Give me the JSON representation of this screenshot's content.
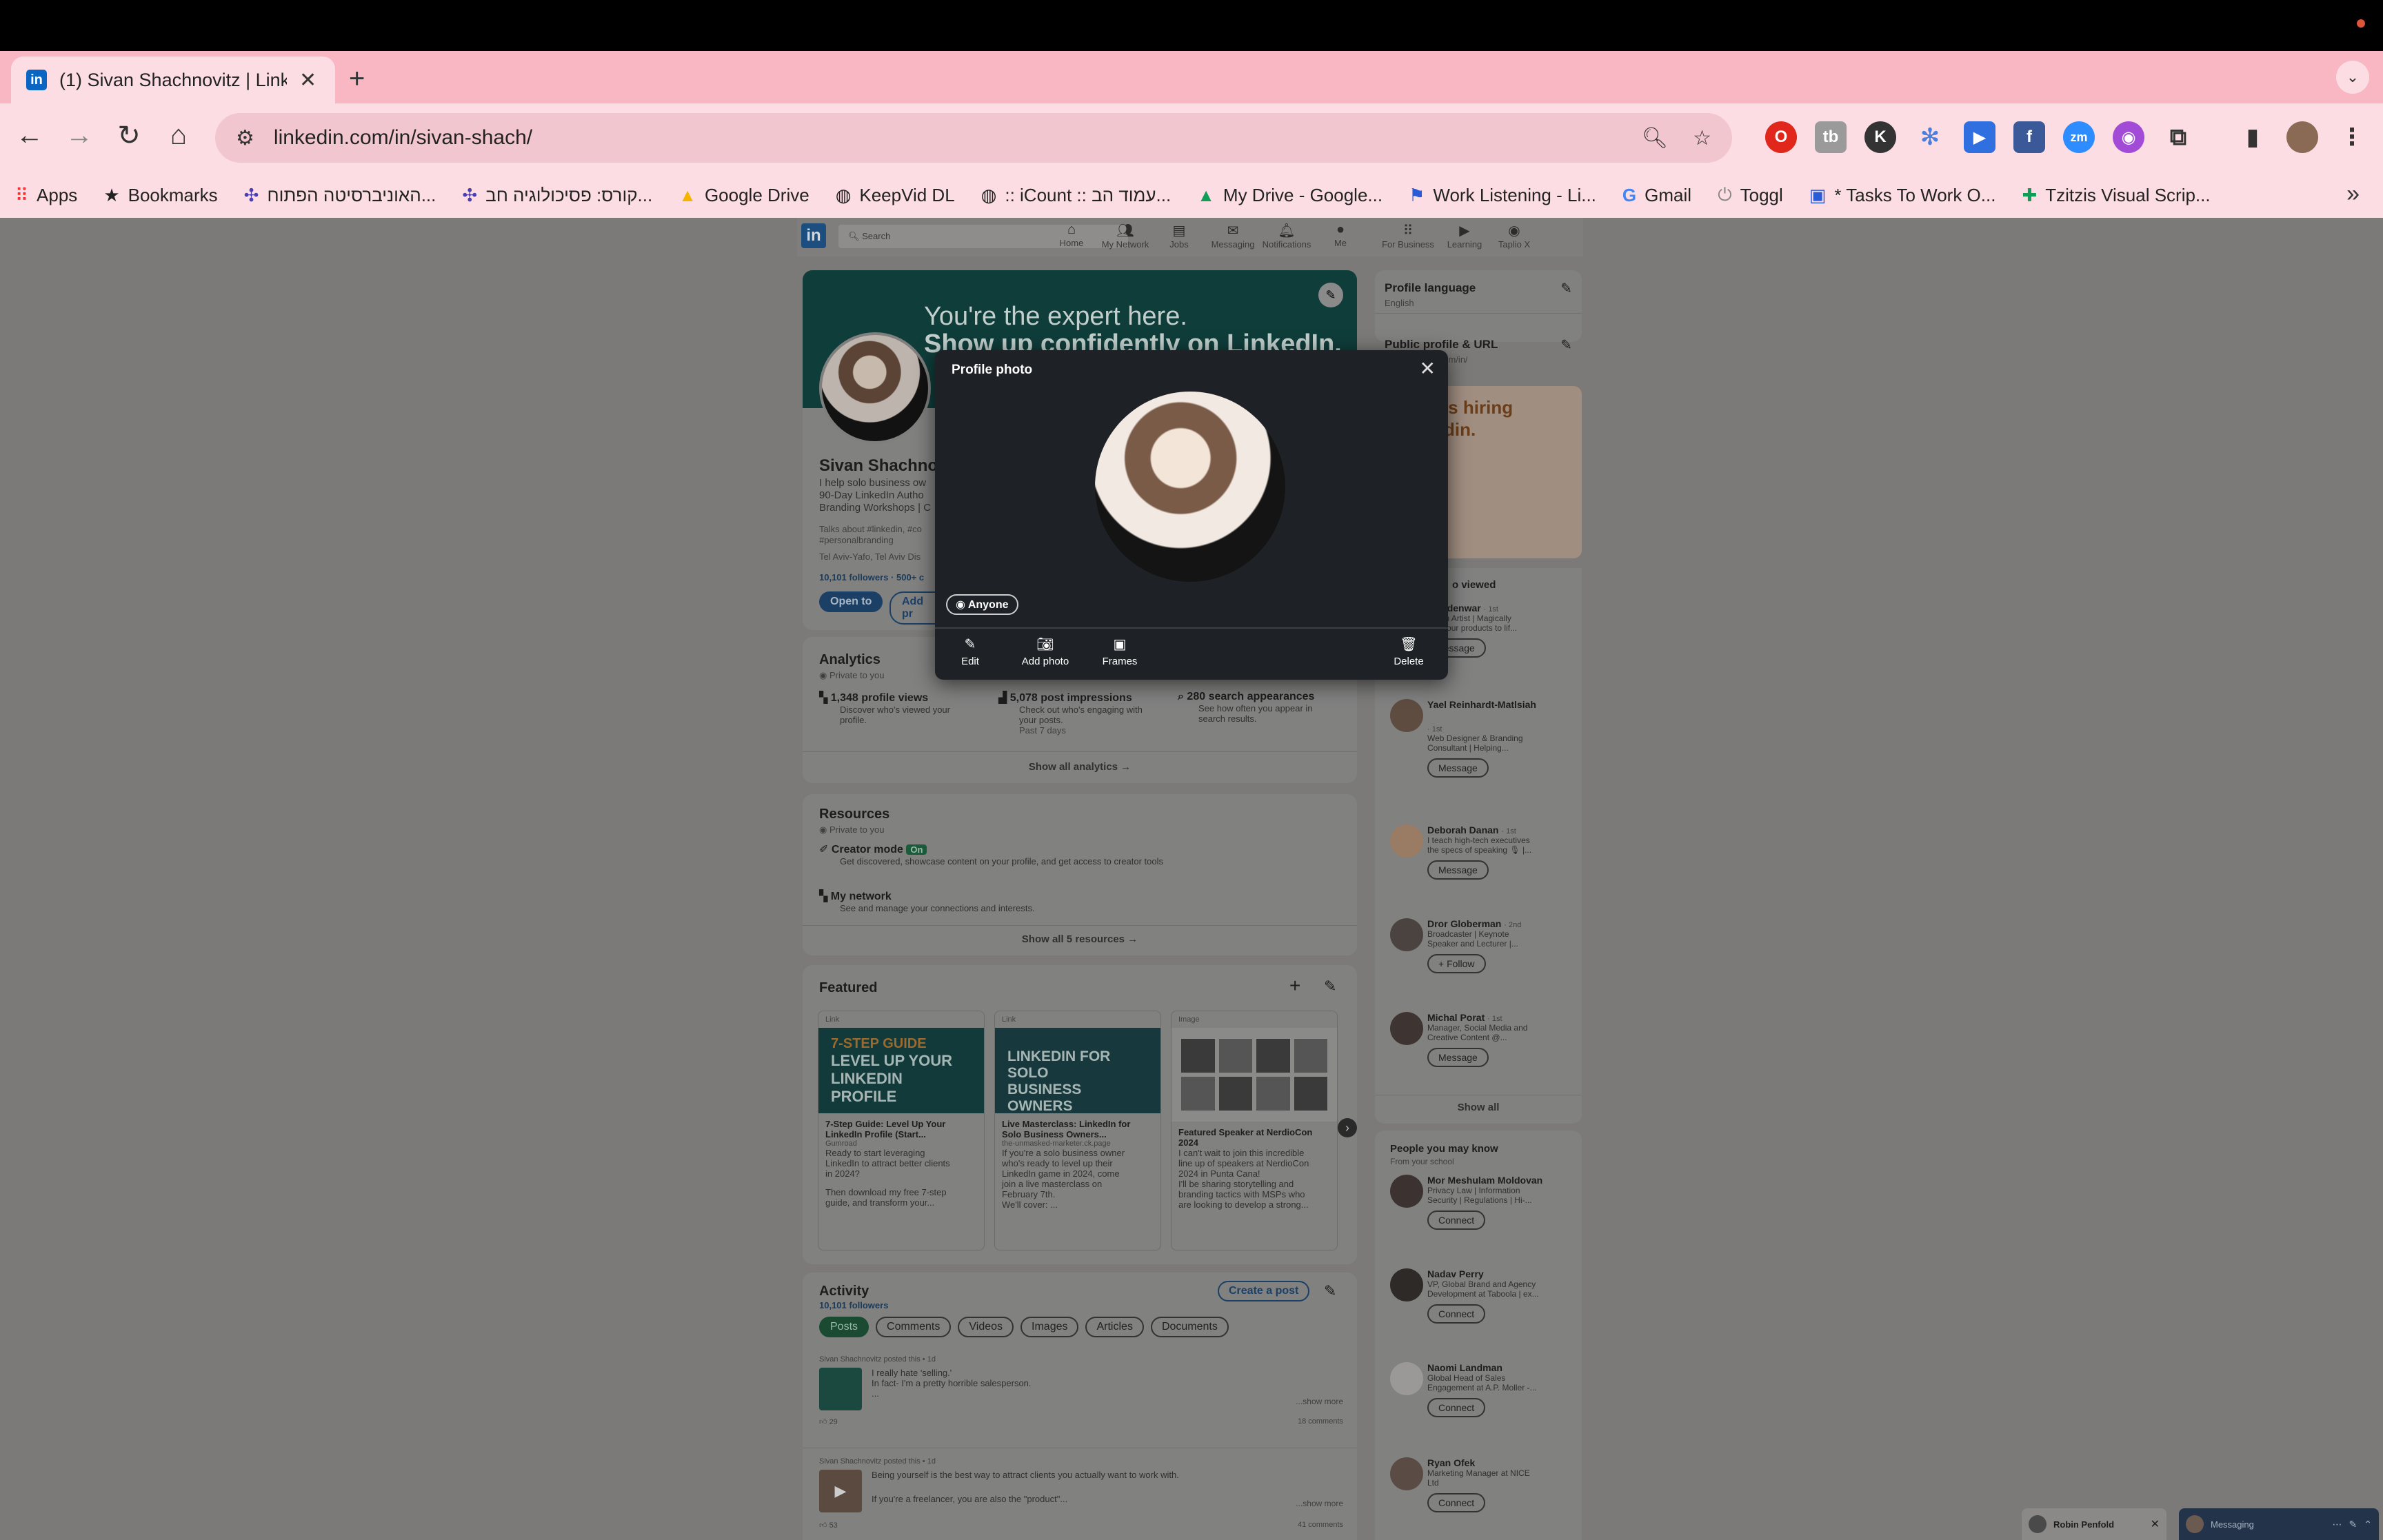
{
  "browser": {
    "tab_title": "(1) Sivan Shachnovitz | LinkedIn",
    "url": "linkedin.com/in/sivan-shach/",
    "bookmarks": [
      "Apps",
      "Bookmarks",
      "האוניברסיטה הפתוח...",
      "קורס: פסיכולוגיה חב...",
      "Google Drive",
      "KeepVid DL",
      ":: iCount :: עמוד הב...",
      "My Drive - Google...",
      "Work Listening - Li...",
      "Gmail",
      "Toggl",
      "* Tasks To Work O...",
      "Tzitzis Visual Scrip..."
    ]
  },
  "linkedin_nav": {
    "search_placeholder": "Search",
    "items": [
      "Home",
      "My Network",
      "Jobs",
      "Messaging",
      "Notifications",
      "Me",
      "For Business",
      "Learning",
      "Taplio X"
    ]
  },
  "profile": {
    "banner_line1": "You're the expert here.",
    "banner_line2": "Show up confidently on LinkedIn.",
    "name": "Sivan Shachnov",
    "headline_1": "I help solo business ow",
    "headline_2": "90-Day LinkedIn Autho",
    "headline_3": "Branding Workshops | C",
    "talks_about": "Talks about #linkedin, #co",
    "hashtag": "#personalbranding",
    "location": "Tel Aviv-Yafo, Tel Aviv Dis",
    "followers": "10,101 followers · 500+ c",
    "open_to": "Open to",
    "add_section": "Add pr"
  },
  "analytics": {
    "title": "Analytics",
    "private": "Private to you",
    "items": [
      {
        "title": "1,348 profile views",
        "desc1": "Discover who's viewed your",
        "desc2": "profile."
      },
      {
        "title": "5,078 post impressions",
        "desc1": "Check out who's engaging with",
        "desc2": "your posts.",
        "desc3": "Past 7 days"
      },
      {
        "title": "280 search appearances",
        "desc1": "See how often you appear in",
        "desc2": "search results."
      }
    ],
    "show_all": "Show all analytics →"
  },
  "resources": {
    "title": "Resources",
    "private": "Private to you",
    "creator_mode": "Creator mode",
    "creator_badge": "On",
    "creator_desc": "Get discovered, showcase content on your profile, and get access to creator tools",
    "network": "My network",
    "network_desc": "See and manage your connections and interests.",
    "show_all": "Show all 5 resources →"
  },
  "featured": {
    "title": "Featured",
    "items": [
      {
        "type": "Link",
        "img_l1": "7-STEP GUIDE",
        "img_l2": "LEVEL UP YOUR",
        "img_l3": "LINKEDIN PROFILE",
        "title1": "7-Step Guide: Level Up Your",
        "title2": "LinkedIn Profile (Start...",
        "source": "Gumroad",
        "d1": "Ready to start leveraging",
        "d2": "LinkedIn to attract better clients",
        "d3": "in 2024?",
        "d4": "Then download my free 7-step",
        "d5": "guide, and transform your..."
      },
      {
        "type": "Link",
        "img_l1": "LINKEDIN FOR SOLO",
        "img_l2": "BUSINESS OWNERS",
        "title1": "Live Masterclass: LinkedIn for",
        "title2": "Solo Business Owners...",
        "source": "the-unmasked-marketer.ck.page",
        "d1": "If you're a solo business owner",
        "d2": "who's ready to level up their",
        "d3": "LinkedIn game in 2024, come",
        "d4": "join a live masterclass on",
        "d5": "February 7th.",
        "d6": "We'll cover: ..."
      },
      {
        "type": "Image",
        "title1": "Featured Speaker at NerdioCon",
        "title2": "2024",
        "d1": "I can't wait to join this incredible",
        "d2": "line up of speakers at NerdioCon",
        "d3": "2024 in Punta Cana!",
        "d4": "I'll be sharing storytelling and",
        "d5": "branding tactics with MSPs who",
        "d6": "are looking to develop a strong..."
      }
    ]
  },
  "activity": {
    "title": "Activity",
    "followers": "10,101 followers",
    "create_post": "Create a post",
    "tabs": [
      "Posts",
      "Comments",
      "Videos",
      "Images",
      "Articles",
      "Documents"
    ],
    "posts": [
      {
        "meta": "Sivan Shachnovitz posted this • 1d",
        "line1": "I really hate 'selling.'",
        "line2": "In fact- I'm a pretty horrible salesperson.",
        "line3": "...",
        "more": "...show more",
        "reactions": "29",
        "comments": "18 comments"
      },
      {
        "meta": "Sivan Shachnovitz posted this • 1d",
        "line1": "Being yourself is the best way to attract clients you actually want to work with.",
        "line2": "If you're a freelancer, you are also the \"product\"...",
        "more": "...show more",
        "reactions": "53",
        "comments": "41 comments"
      }
    ]
  },
  "sidebar": {
    "profile_language": "Profile language",
    "language": "English",
    "public_profile": "Public profile & URL",
    "public_url": "www.linkedin.com/in/sivan-shach",
    "ad_line1": "'s hiring",
    "ad_line2": "din.",
    "viewed_title": "o viewed",
    "viewed": [
      {
        "name": "a Seidenwar",
        "deg": "· 1st",
        "d1": "Motion Artist | Magically",
        "d2": "ging your products to lif...",
        "btn": "Message"
      },
      {
        "name": "Yael Reinhardt-Matlsiah",
        "deg": "· 1st",
        "d1": "Web Designer & Branding",
        "d2": "Consultant | Helping...",
        "btn": "Message"
      },
      {
        "name": "Deborah Danan",
        "deg": "· 1st",
        "d1": "I teach high-tech executives",
        "d2": "the specs of speaking 🎙 |...",
        "btn": "Message"
      },
      {
        "name": "Dror Globerman",
        "deg": "· 2nd",
        "d1": "Broadcaster | Keynote",
        "d2": "Speaker and Lecturer |...",
        "btn": "+ Follow"
      },
      {
        "name": "Michal Porat",
        "deg": "· 1st",
        "d1": "Manager, Social Media and",
        "d2": "Creative Content @...",
        "btn": "Message"
      }
    ],
    "show_all": "Show all",
    "pymk_title": "People you may know",
    "pymk_sub": "From your school",
    "pymk": [
      {
        "name": "Mor Meshulam Moldovan",
        "d1": "Privacy Law | Information",
        "d2": "Security | Regulations | Hi-...",
        "btn": "Connect"
      },
      {
        "name": "Nadav Perry",
        "d1": "VP, Global Brand and Agency",
        "d2": "Development at Taboola | ex...",
        "btn": "Connect"
      },
      {
        "name": "Naomi Landman",
        "d1": "Global Head of Sales",
        "d2": "Engagement at A.P. Moller -...",
        "btn": "Connect"
      },
      {
        "name": "Ryan Ofek",
        "d1": "Marketing Manager at NICE",
        "d2": "Ltd",
        "btn": "Connect"
      }
    ]
  },
  "messaging": {
    "chat_name": "Robin Penfold",
    "label": "Messaging"
  },
  "modal": {
    "title": "Profile photo",
    "visibility": "Anyone",
    "edit": "Edit",
    "add_photo": "Add photo",
    "frames": "Frames",
    "delete": "Delete"
  },
  "colors": {
    "linkedin_blue": "#0a66c2",
    "tab_pink": "#f9b6c3",
    "modal_bg": "#1e2226"
  }
}
